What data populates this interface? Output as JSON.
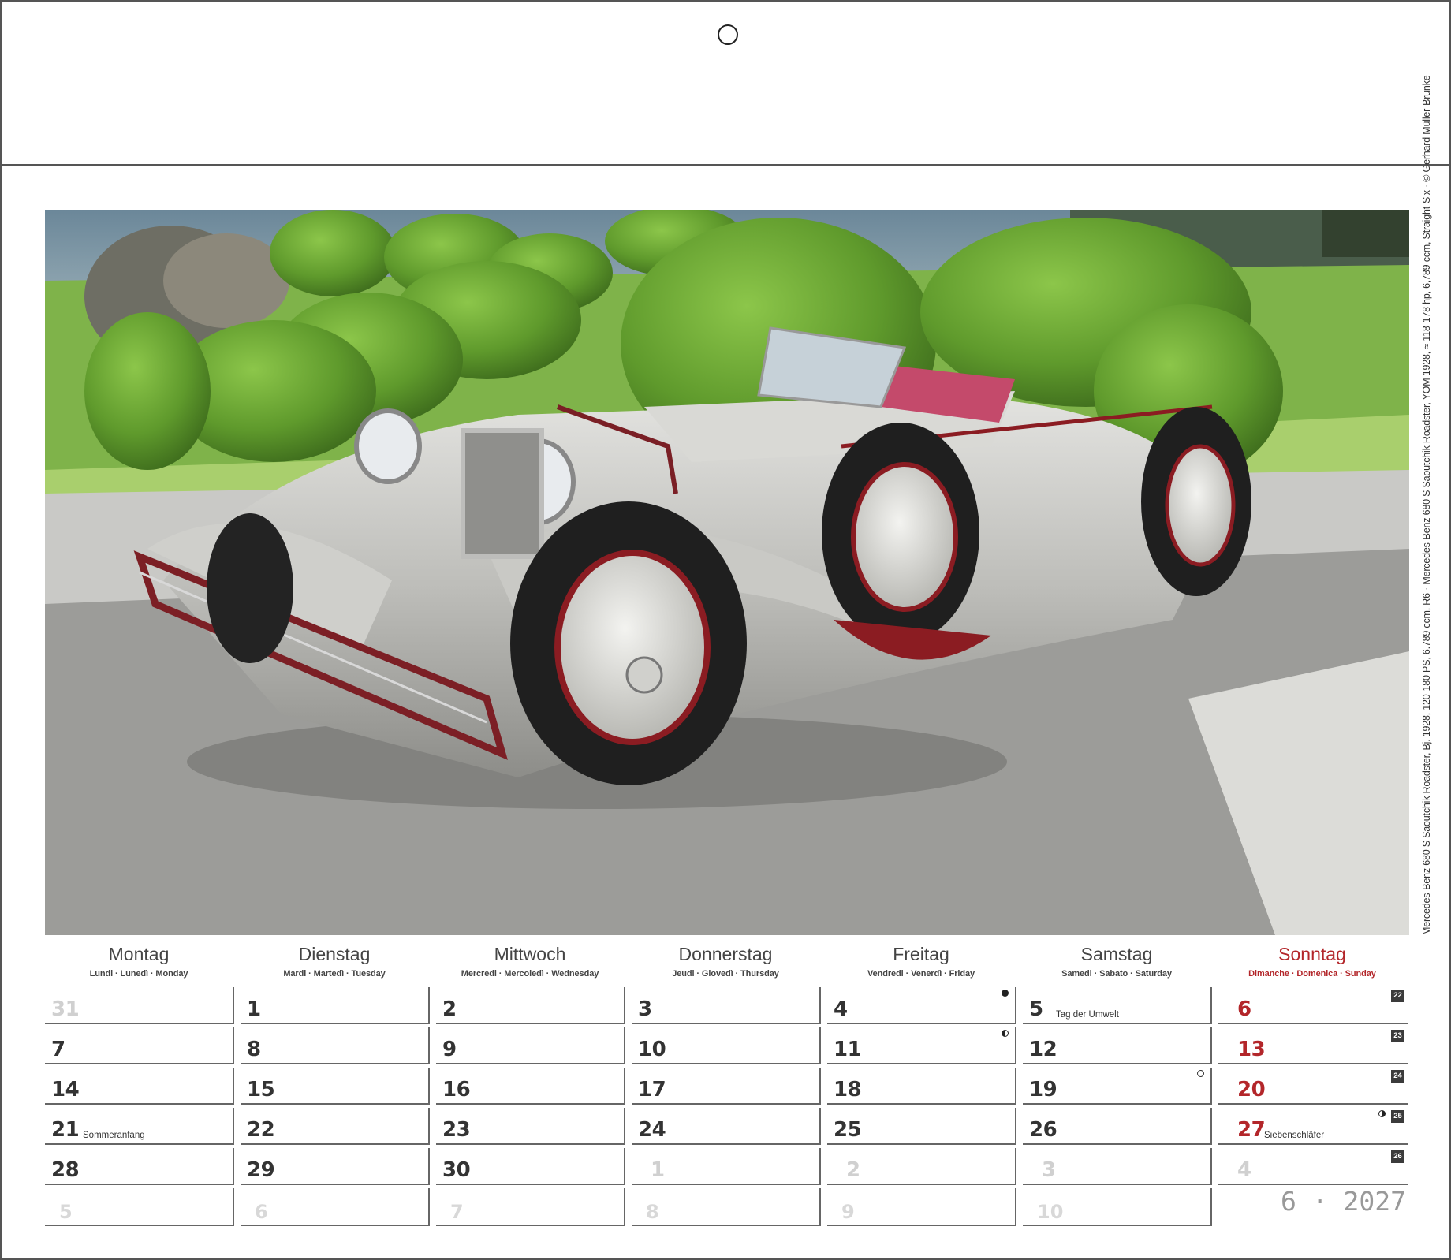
{
  "caption": "Mercedes-Benz 680 S Saoutchik Roadster, Bj. 1928, 120-180 PS, 6.789 ccm, R6 · Mercedes-Benz 680 S Saoutchik Roadster, YOM 1928, ≈ 118-178 hp, 6,789 ccm, Straight-Six · © Gerhard Müller-Brunke",
  "days": [
    {
      "name": "Montag",
      "sub": "Lundi · Lunedì · Monday"
    },
    {
      "name": "Dienstag",
      "sub": "Mardi · Martedì · Tuesday"
    },
    {
      "name": "Mittwoch",
      "sub": "Mercredi · Mercoledì · Wednesday"
    },
    {
      "name": "Donnerstag",
      "sub": "Jeudi · Giovedì · Thursday"
    },
    {
      "name": "Freitag",
      "sub": "Vendredi · Venerdì · Friday"
    },
    {
      "name": "Samstag",
      "sub": "Samedi · Sabato · Saturday"
    },
    {
      "name": "Sonntag",
      "sub": "Dimanche · Domenica · Sunday"
    }
  ],
  "weeks": [
    {
      "week": "22",
      "cells": [
        "31",
        "1",
        "2",
        "3",
        "4",
        "5",
        "6"
      ]
    },
    {
      "week": "23",
      "cells": [
        "7",
        "8",
        "9",
        "10",
        "11",
        "12",
        "13"
      ]
    },
    {
      "week": "24",
      "cells": [
        "14",
        "15",
        "16",
        "17",
        "18",
        "19",
        "20"
      ]
    },
    {
      "week": "25",
      "cells": [
        "21",
        "22",
        "23",
        "24",
        "25",
        "26",
        "27"
      ]
    },
    {
      "week": "26",
      "cells": [
        "28",
        "29",
        "30",
        "1",
        "2",
        "3",
        "4"
      ]
    }
  ],
  "overflow_row": [
    "5",
    "6",
    "7",
    "8",
    "9",
    "10"
  ],
  "notes": {
    "sat_5": "Tag der Umwelt",
    "mon_21": "Sommeranfang",
    "sun_27": "Siebenschläfer"
  },
  "month_label": "6 · 2027",
  "colors": {
    "sunday_red": "#b3262a",
    "week_badge": "#3b3b3b",
    "rule": "#666666"
  }
}
